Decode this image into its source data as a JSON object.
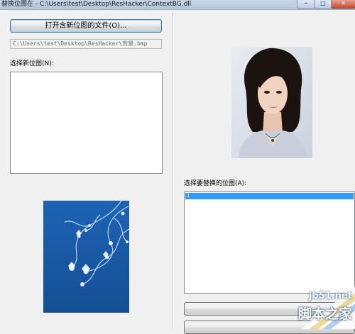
{
  "window": {
    "title": "替换位图在 - C:\\Users\\test\\Desktop\\ResHacker\\ContextBG.dll",
    "controls": [
      "─",
      "□",
      "✕"
    ]
  },
  "left": {
    "open_button": "打开含新位图的文件(O)...",
    "path": "C:\\Users\\test\\Desktop\\ResHacker\\背景.bmp",
    "select_new_label": "选择新位图(N):"
  },
  "right": {
    "select_replace_label": "选择要替换的位图(A):",
    "list_items": [
      "1"
    ]
  },
  "watermark": {
    "site": "jb51.net",
    "name": "脚本之家"
  },
  "colors": {
    "preview_blue": "#1e5fae",
    "selection": "#3399ff"
  }
}
